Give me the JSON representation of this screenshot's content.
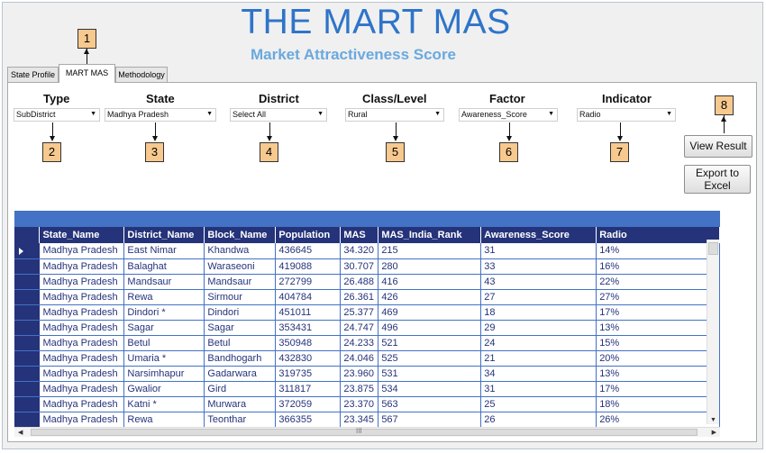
{
  "header": {
    "title": "THE MART MAS",
    "subtitle": "Market Attractiveness Score"
  },
  "tabs": [
    {
      "label": "State Profile",
      "active": false
    },
    {
      "label": "MART MAS",
      "active": true
    },
    {
      "label": "Methodology",
      "active": false
    }
  ],
  "filters": {
    "type": {
      "label": "Type",
      "value": "SubDistrict"
    },
    "state": {
      "label": "State",
      "value": "Madhya Pradesh"
    },
    "district": {
      "label": "District",
      "value": "Select All"
    },
    "class_level": {
      "label": "Class/Level",
      "value": "Rural"
    },
    "factor": {
      "label": "Factor",
      "value": "Awareness_Score"
    },
    "indicator": {
      "label": "Indicator",
      "value": "Radio"
    }
  },
  "buttons": {
    "view_result": "View Result",
    "export_line1": "Export to",
    "export_line2": "Excel"
  },
  "callouts": [
    "1",
    "2",
    "3",
    "4",
    "5",
    "6",
    "7",
    "8"
  ],
  "grid": {
    "columns": [
      "State_Name",
      "District_Name",
      "Block_Name",
      "Population",
      "MAS",
      "MAS_India_Rank",
      "Awareness_Score",
      "Radio"
    ],
    "rows": [
      [
        "Madhya Pradesh",
        "East Nimar",
        "Khandwa",
        "436645",
        "34.320",
        "215",
        "31",
        "14%"
      ],
      [
        "Madhya Pradesh",
        "Balaghat",
        "Waraseoni",
        "419088",
        "30.707",
        "280",
        "33",
        "16%"
      ],
      [
        "Madhya Pradesh",
        "Mandsaur",
        "Mandsaur",
        "272799",
        "26.488",
        "416",
        "43",
        "22%"
      ],
      [
        "Madhya Pradesh",
        "Rewa",
        "Sirmour",
        "404784",
        "26.361",
        "426",
        "27",
        "27%"
      ],
      [
        "Madhya Pradesh",
        "Dindori *",
        "Dindori",
        "451011",
        "25.377",
        "469",
        "18",
        "17%"
      ],
      [
        "Madhya Pradesh",
        "Sagar",
        "Sagar",
        "353431",
        "24.747",
        "496",
        "29",
        "13%"
      ],
      [
        "Madhya Pradesh",
        "Betul",
        "Betul",
        "350948",
        "24.233",
        "521",
        "24",
        "15%"
      ],
      [
        "Madhya Pradesh",
        "Umaria *",
        "Bandhogarh",
        "432830",
        "24.046",
        "525",
        "21",
        "20%"
      ],
      [
        "Madhya Pradesh",
        "Narsimhapur",
        "Gadarwara",
        "319735",
        "23.960",
        "531",
        "34",
        "13%"
      ],
      [
        "Madhya Pradesh",
        "Gwalior",
        "Gird",
        "311817",
        "23.875",
        "534",
        "31",
        "17%"
      ],
      [
        "Madhya Pradesh",
        "Katni *",
        "Murwara",
        "372059",
        "23.370",
        "563",
        "25",
        "18%"
      ],
      [
        "Madhya Pradesh",
        "Rewa",
        "Teonthar",
        "366355",
        "23.345",
        "567",
        "26",
        "26%"
      ]
    ]
  },
  "scrollbar_marker": "III"
}
